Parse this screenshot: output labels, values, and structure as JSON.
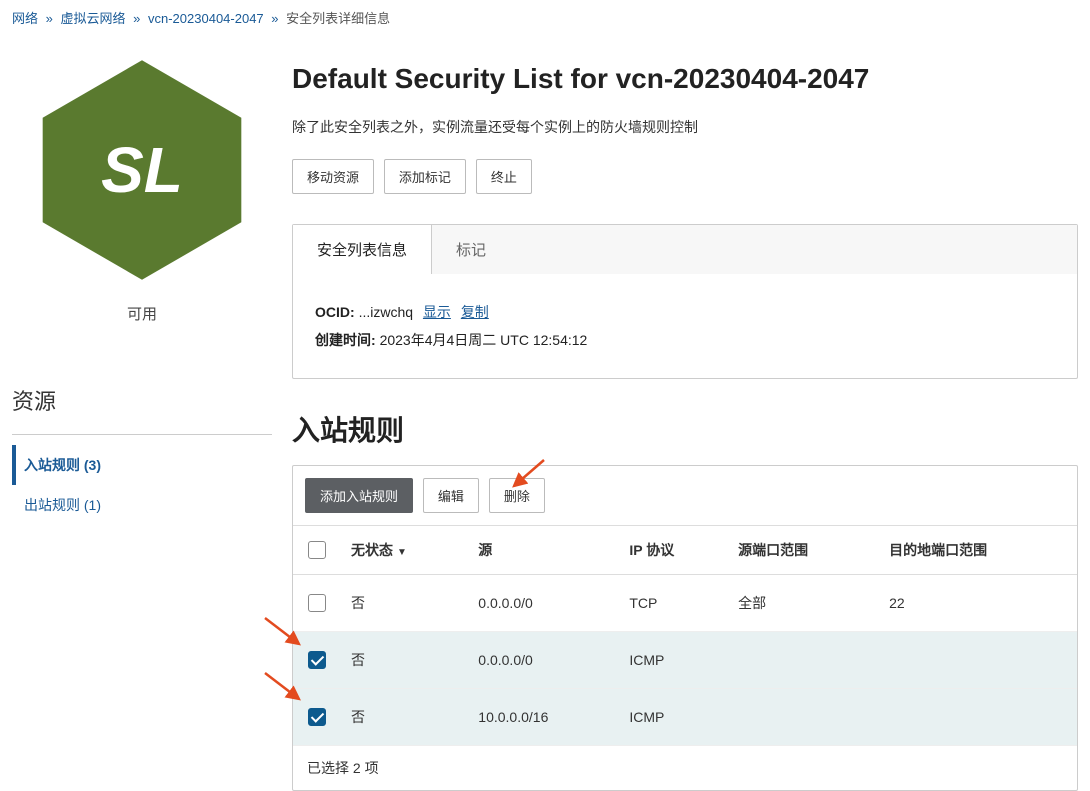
{
  "breadcrumb": {
    "items": [
      {
        "label": "网络",
        "link": true
      },
      {
        "label": "虚拟云网络",
        "link": true
      },
      {
        "label": "vcn-20230404-2047",
        "link": true
      },
      {
        "label": "安全列表详细信息",
        "link": false
      }
    ]
  },
  "badge": {
    "text": "SL",
    "color": "#5a7a2f"
  },
  "status": "可用",
  "resources": {
    "heading": "资源",
    "items": [
      {
        "label": "入站规则 (3)",
        "active": true
      },
      {
        "label": "出站规则 (1)",
        "active": false
      }
    ]
  },
  "page": {
    "title": "Default Security List for vcn-20230404-2047",
    "description": "除了此安全列表之外，实例流量还受每个实例上的防火墙规则控制"
  },
  "actions": {
    "move": "移动资源",
    "addTag": "添加标记",
    "terminate": "终止"
  },
  "tabs": {
    "info": "安全列表信息",
    "tags": "标记"
  },
  "details": {
    "ocidLabel": "OCID:",
    "ocidValue": "...izwchq",
    "showLink": "显示",
    "copyLink": "复制",
    "createdLabel": "创建时间:",
    "createdValue": "2023年4月4日周二 UTC 12:54:12"
  },
  "ingress": {
    "title": "入站规则",
    "addBtn": "添加入站规则",
    "editBtn": "编辑",
    "deleteBtn": "删除",
    "columns": {
      "stateless": "无状态",
      "source": "源",
      "protocol": "IP 协议",
      "srcPort": "源端口范围",
      "dstPort": "目的地端口范围"
    },
    "rows": [
      {
        "checked": false,
        "stateless": "否",
        "source": "0.0.0.0/0",
        "protocol": "TCP",
        "srcPort": "全部",
        "dstPort": "22"
      },
      {
        "checked": true,
        "stateless": "否",
        "source": "0.0.0.0/0",
        "protocol": "ICMP",
        "srcPort": "",
        "dstPort": ""
      },
      {
        "checked": true,
        "stateless": "否",
        "source": "10.0.0.0/16",
        "protocol": "ICMP",
        "srcPort": "",
        "dstPort": ""
      }
    ],
    "selectionText": "已选择 2 项"
  }
}
